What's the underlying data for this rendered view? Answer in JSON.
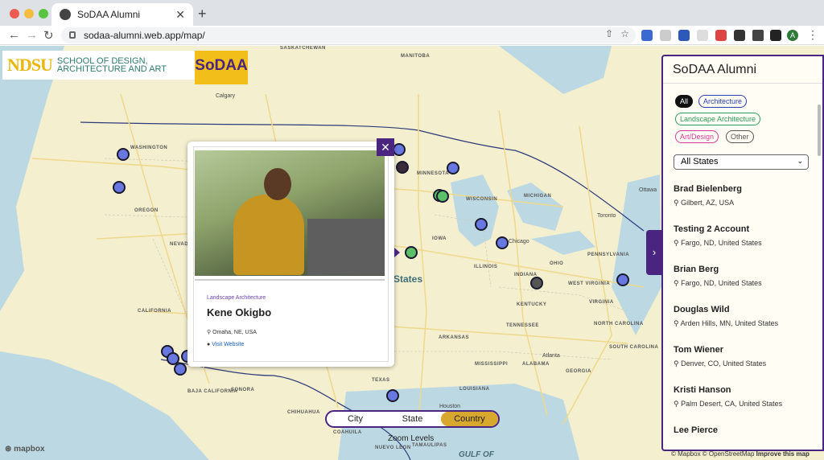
{
  "browser": {
    "tab_title": "SoDAA Alumni",
    "url": "sodaa-alumni.web.app/map/",
    "profile_initial": "A"
  },
  "header": {
    "ndsu": "NDSU",
    "school": "SCHOOL OF DESIGN, ARCHITECTURE AND ART",
    "sodaa": "SoDAA"
  },
  "map": {
    "region_labels": [
      "WASHINGTON",
      "OREGON",
      "CALIFORNIA",
      "NEVADA",
      "MINNESOTA",
      "WISCONSIN",
      "IOWA",
      "ILLINOIS",
      "MICHIGAN",
      "OHIO",
      "INDIANA",
      "KENTUCKY",
      "TENNESSEE",
      "ARKANSAS",
      "MISSISSIPPI",
      "ALABAMA",
      "GEORGIA",
      "WEST VIRGINIA",
      "VIRGINIA",
      "PENNSYLVANIA",
      "NORTH CAROLINA",
      "SOUTH CAROLINA",
      "LOUISIANA",
      "TEXAS",
      "BAJA CALIFORNIA",
      "SONORA",
      "CHIHUAHUA",
      "COAHUILA",
      "NUEVO LEON",
      "TAMAULIPAS",
      "SASKATCHEWAN",
      "MANITOBA"
    ],
    "cities": [
      "Calgary",
      "Chicago",
      "Toronto",
      "Atlanta",
      "Houston",
      "Ottawa"
    ],
    "country_label": "States",
    "gulf": "GULF OF",
    "mapbox": "mapbox",
    "attribution": "© Mapbox © OpenStreetMap",
    "improve": "Improve this map"
  },
  "popup": {
    "category": "Landscape Architecture",
    "name": "Kene Okigbo",
    "location": "Omaha, NE, USA",
    "link": "Visit Website"
  },
  "zoom": {
    "options": [
      "City",
      "State",
      "Country"
    ],
    "selected": "Country",
    "label": "Zoom Levels"
  },
  "panel": {
    "title": "SoDAA Alumni",
    "filters": [
      {
        "label": "All",
        "color": "#111111",
        "filled": true
      },
      {
        "label": "Architecture",
        "color": "#2a3fb0"
      },
      {
        "label": "Landscape Architecture",
        "color": "#2e9a5a"
      },
      {
        "label": "Art/Design",
        "color": "#d63a9a"
      },
      {
        "label": "Other",
        "color": "#555555"
      }
    ],
    "state_select": "All States",
    "alumni": [
      {
        "name": "Brad Bielenberg",
        "location": "Gilbert, AZ, USA"
      },
      {
        "name": "Testing 2 Account",
        "location": "Fargo, ND, United States"
      },
      {
        "name": "Brian Berg",
        "location": "Fargo, ND, United States"
      },
      {
        "name": "Douglas Wild",
        "location": "Arden Hills, MN, United States"
      },
      {
        "name": "Tom Wiener",
        "location": "Denver, CO, United States"
      },
      {
        "name": "Kristi Hanson",
        "location": "Palm Desert, CA, United States"
      },
      {
        "name": "Lee Pierce",
        "location": ""
      }
    ]
  },
  "colors": {
    "accent": "#4a2580",
    "gold": "#d8a82e",
    "architecture": "#6878e0",
    "landscape": "#5cbf6a",
    "other": "#555555"
  }
}
